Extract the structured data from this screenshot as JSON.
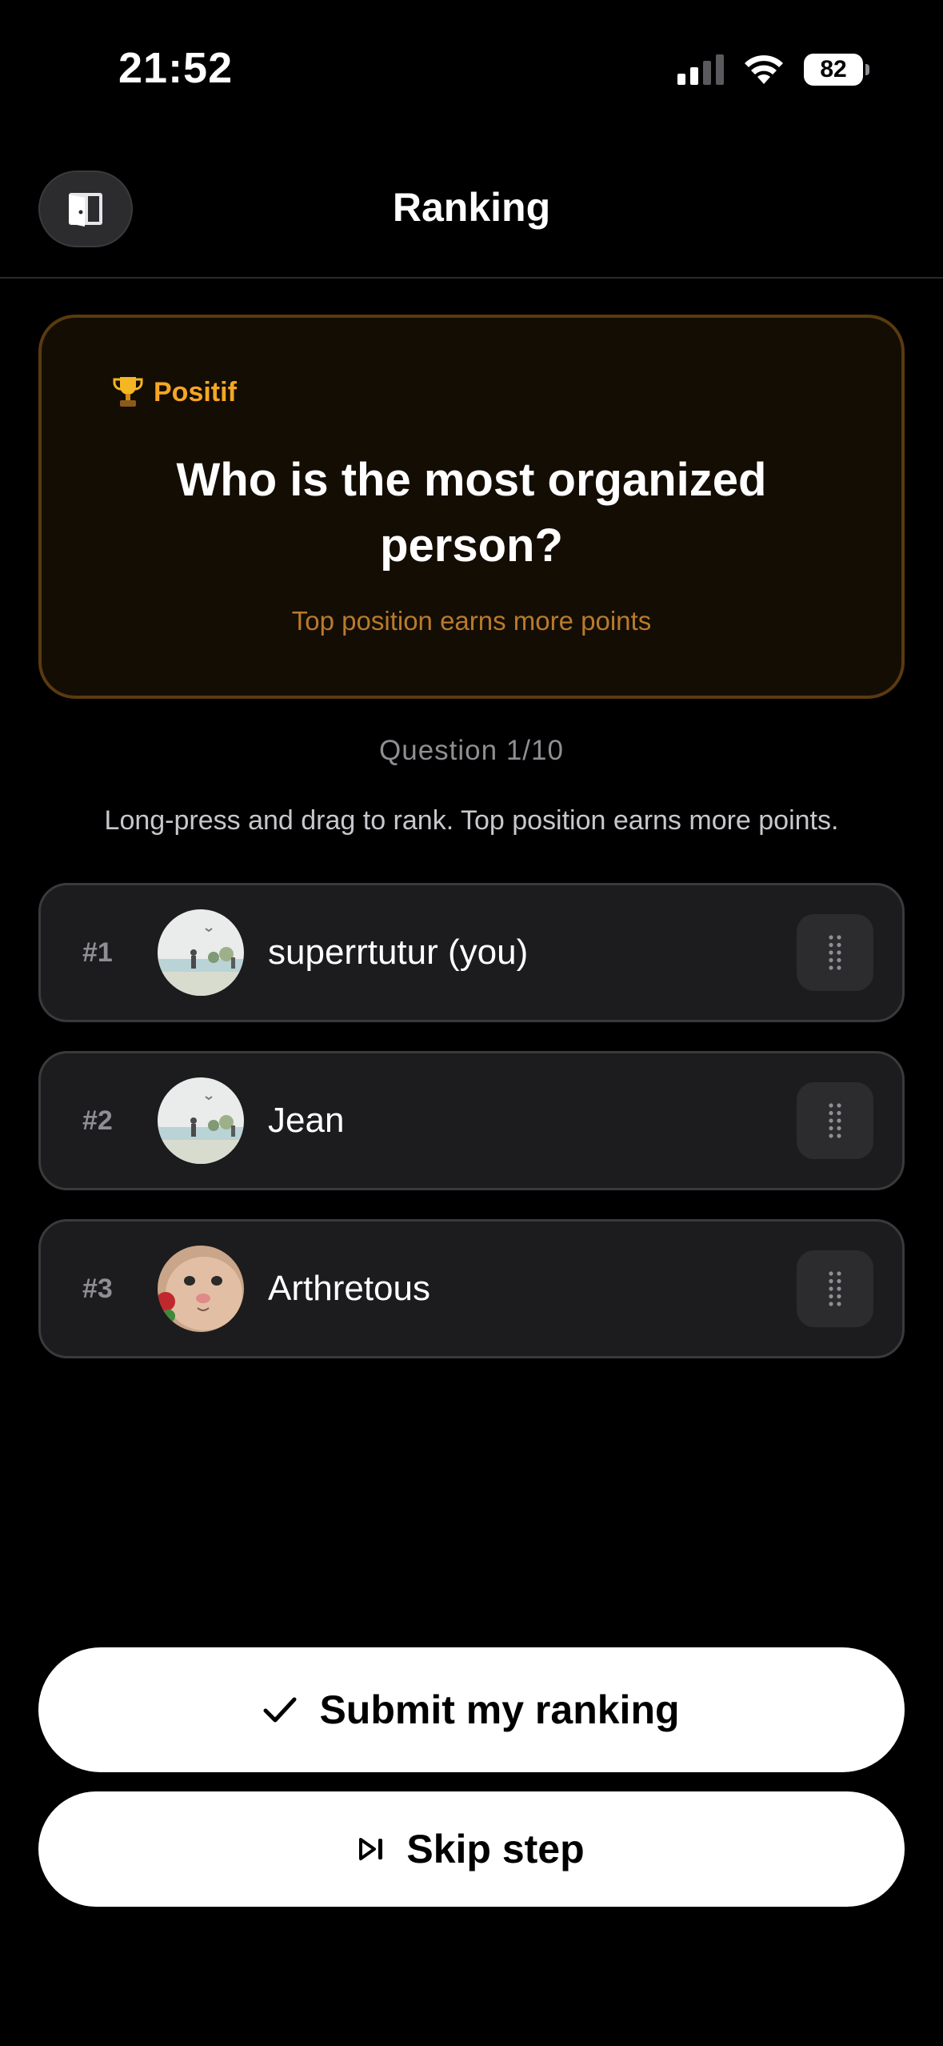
{
  "status_bar": {
    "time": "21:52",
    "battery": "82",
    "icons": [
      "signal-icon",
      "wifi-icon",
      "battery-icon"
    ]
  },
  "header": {
    "title": "Ranking",
    "exit_icon": "door-exit-icon"
  },
  "question_card": {
    "category_icon": "trophy-icon",
    "category": "Positif",
    "question": "Who is the most organized person?",
    "hint": "Top position earns more points",
    "accent_color": "#f5a623"
  },
  "progress": {
    "counter": "Question 1/10"
  },
  "instructions": "Long-press and drag to rank. Top position earns more points.",
  "ranking": [
    {
      "position": "#1",
      "name": "superrtutur (you)",
      "avatar": "beach-figures-avatar"
    },
    {
      "position": "#2",
      "name": "Jean",
      "avatar": "beach-figures-avatar"
    },
    {
      "position": "#3",
      "name": "Arthretous",
      "avatar": "cat-face-avatar"
    }
  ],
  "actions": {
    "submit_label": "Submit my ranking",
    "submit_icon": "checkmark-icon",
    "skip_label": "Skip step",
    "skip_icon": "skip-forward-icon"
  }
}
